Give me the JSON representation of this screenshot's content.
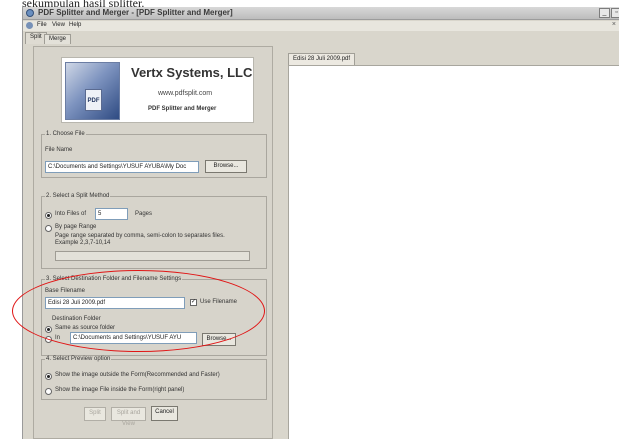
{
  "caption_text": "sekumpulan hasil splitter.",
  "window": {
    "title": "PDF Splitter and Merger - [PDF Splitter and Merger]",
    "minimize": "_",
    "restore": "▫"
  },
  "menu": {
    "file": "File",
    "view": "View",
    "help": "Help",
    "close": "×"
  },
  "tabs": {
    "split": "Split",
    "merge": "Merge"
  },
  "logo": {
    "company": "Vertx Systems, LLC",
    "website": "www.pdfsplit.com",
    "product": "PDF Splitter and Merger",
    "doc_label": "PDF"
  },
  "section1": {
    "legend": "1. Choose File",
    "file_name_label": "File Name",
    "file_name_value": "C:\\Documents and Settings\\YUSUF AYUBA\\My Doc",
    "browse": "Browse..."
  },
  "section2": {
    "legend": "2. Select a Split Method",
    "into_files_of": "Into Files of",
    "pages_value": "5",
    "pages_label": "Pages",
    "by_page_range": "By page Range",
    "help_line1": "Page range separated by comma, semi-colon to separates files.",
    "help_line2": "Example 2,3,7-10,14",
    "into_files_selected": true
  },
  "section3": {
    "legend": "3. Select Destination Folder and Filename Settings",
    "base_filename_label": "Base Filename",
    "base_filename_value": "Edisi 28 Juli 2009.pdf",
    "use_filename": "Use Filename",
    "use_filename_checked": true,
    "destination_label": "Destination Folder",
    "same_as_source": "Same as source folder",
    "in_label": "In",
    "in_path": "C:\\Documents and Settings\\YUSUF AYU",
    "browse": "Browse..."
  },
  "section4": {
    "legend": "4. Select Preview option",
    "option_outside": "Show the image outside the Form(Recommended and Faster)",
    "option_inside": "Show the image File inside the Form(right panel)"
  },
  "actions": {
    "split": "Split",
    "split_and_view": "Split and View",
    "cancel": "Cancel"
  },
  "preview": {
    "tab_label": "Edisi 28 Juli 2009.pdf"
  },
  "colors": {
    "annotation": "#e01515",
    "window_bg": "#d9d6cc"
  }
}
